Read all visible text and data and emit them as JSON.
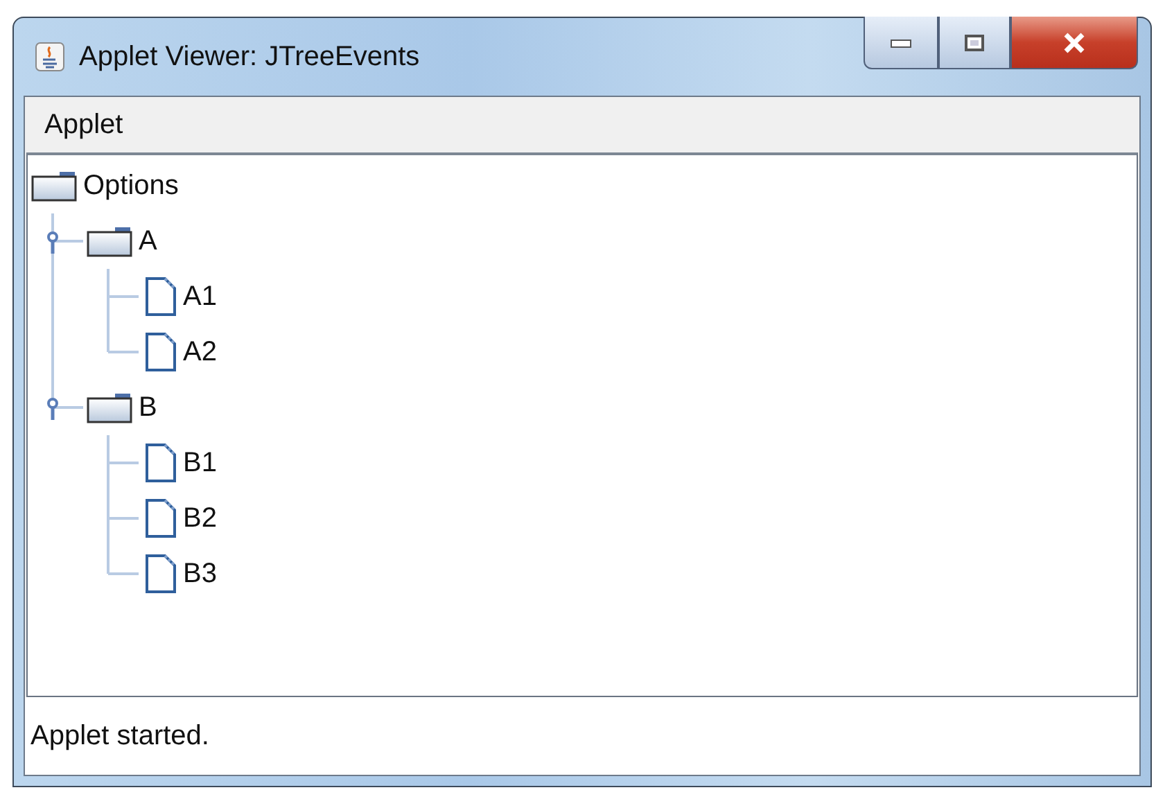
{
  "window": {
    "title": "Applet Viewer: JTreeEvents"
  },
  "menu": [
    "Applet"
  ],
  "tree": {
    "label": "Options",
    "kind": "folder",
    "children": [
      {
        "label": "A",
        "kind": "folder",
        "expanded": true,
        "children": [
          {
            "label": "A1",
            "kind": "leaf"
          },
          {
            "label": "A2",
            "kind": "leaf"
          }
        ]
      },
      {
        "label": "B",
        "kind": "folder",
        "expanded": true,
        "children": [
          {
            "label": "B1",
            "kind": "leaf"
          },
          {
            "label": "B2",
            "kind": "leaf"
          },
          {
            "label": "B3",
            "kind": "leaf"
          }
        ]
      }
    ]
  },
  "status_bar": "Applet started."
}
